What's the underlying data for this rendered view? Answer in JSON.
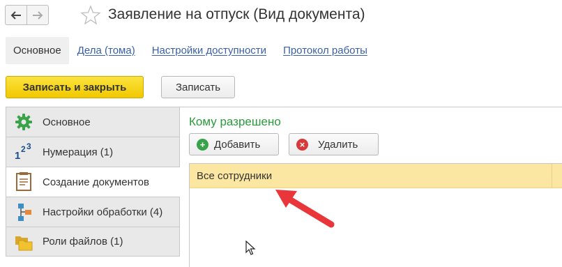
{
  "header": {
    "title": "Заявление на отпуск (Вид документа)",
    "back_icon": "arrow-left-icon",
    "forward_icon": "arrow-right-icon",
    "favorite_icon": "star-icon"
  },
  "top_tabs": [
    {
      "label": "Основное",
      "active": true
    },
    {
      "label": "Дела (тома)",
      "active": false
    },
    {
      "label": "Настройки доступности",
      "active": false
    },
    {
      "label": "Протокол работы",
      "active": false
    }
  ],
  "toolbar": {
    "save_close_label": "Записать и закрыть",
    "save_label": "Записать"
  },
  "left_panel": {
    "items": [
      {
        "label": "Основное",
        "icon": "gear-icon",
        "active": false
      },
      {
        "label": "Нумерация (1)",
        "icon": "numbering-icon",
        "active": false
      },
      {
        "label": "Создание документов",
        "icon": "document-icon",
        "active": true
      },
      {
        "label": "Настройки обработки (4)",
        "icon": "workflow-icon",
        "active": false
      },
      {
        "label": "Роли файлов (1)",
        "icon": "folders-icon",
        "active": false
      }
    ]
  },
  "content": {
    "section_title": "Кому разрешено",
    "add_label": "Добавить",
    "delete_label": "Удалить",
    "rows": [
      {
        "text": "Все сотрудники",
        "selected": true
      }
    ]
  },
  "colors": {
    "accent_green": "#2a9a3b",
    "primary_button": "#f1c800",
    "selected_row": "#fbe7a1",
    "link": "#3a5fa8",
    "annotation_arrow": "#e8363a"
  }
}
